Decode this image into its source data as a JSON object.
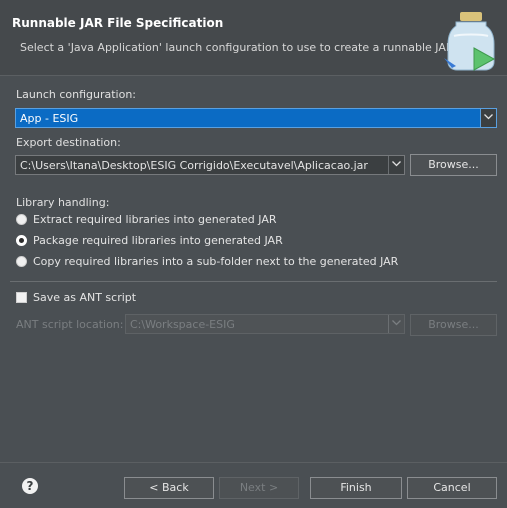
{
  "header": {
    "title": "Runnable JAR File Specification",
    "subtitle": "Select a 'Java Application' launch configuration to use to create a runnable JAR."
  },
  "launch": {
    "label": "Launch configuration:",
    "value": "App - ESIG"
  },
  "export": {
    "label": "Export destination:",
    "value": "C:\\Users\\Itana\\Desktop\\ESIG Corrigido\\Executavel\\Aplicacao.jar",
    "browse_label": "Browse..."
  },
  "library": {
    "label": "Library handling:",
    "options": [
      {
        "label": "Extract required libraries into generated JAR",
        "checked": false
      },
      {
        "label": "Package required libraries into generated JAR",
        "checked": true
      },
      {
        "label": "Copy required libraries into a sub-folder next to the generated JAR",
        "checked": false
      }
    ]
  },
  "ant": {
    "save_label": "Save as ANT script",
    "location_label": "ANT script location:",
    "location_value": "C:\\Workspace-ESIG",
    "browse_label": "Browse..."
  },
  "footer": {
    "back_label": "< Back",
    "next_label": "Next >",
    "finish_label": "Finish",
    "cancel_label": "Cancel"
  },
  "icons": {
    "help": "help-icon",
    "wizard": "jar-wizard-icon",
    "dropdown": "chevron-down-icon"
  },
  "colors": {
    "background": "#4a4f53",
    "selection": "#0b6bc4"
  }
}
